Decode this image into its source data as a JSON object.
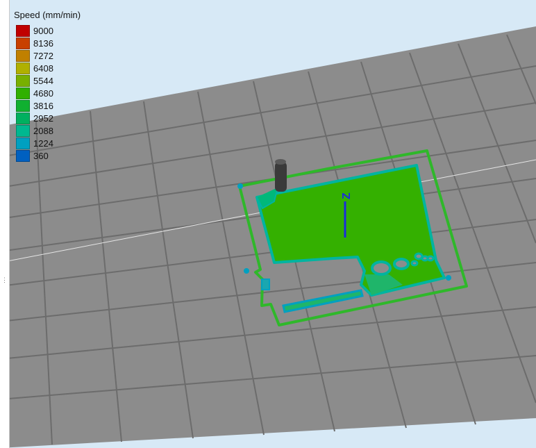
{
  "legend": {
    "title": "Speed (mm/min)",
    "entries": [
      {
        "value": "9000",
        "color": "#c00000"
      },
      {
        "value": "8136",
        "color": "#c84000"
      },
      {
        "value": "7272",
        "color": "#c08000"
      },
      {
        "value": "6408",
        "color": "#b0b000"
      },
      {
        "value": "5544",
        "color": "#78b000"
      },
      {
        "value": "4680",
        "color": "#30b000"
      },
      {
        "value": "3816",
        "color": "#10b030"
      },
      {
        "value": "2952",
        "color": "#00b060"
      },
      {
        "value": "2088",
        "color": "#00b890"
      },
      {
        "value": "1224",
        "color": "#00a0c0"
      },
      {
        "value": "360",
        "color": "#0060c0"
      }
    ]
  },
  "scene": {
    "background_color": "#d7e9f6",
    "bed_color": "#8c8c8c",
    "grid_line_color": "#6f6f6f",
    "part_fill_color": "#34b000",
    "perimeter_color": "#00b4a0",
    "skirt_color": "#2fb82a",
    "nozzle_color": "#3a3a3a",
    "z_axis_color": "#1a2be0",
    "z_axis_label": "Z"
  },
  "splitter": {
    "grip": "⋮"
  }
}
